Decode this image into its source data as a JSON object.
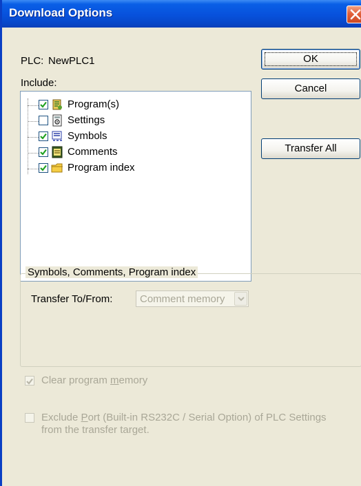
{
  "window": {
    "title": "Download Options"
  },
  "plc": {
    "label": "PLC:",
    "name": "NewPLC1"
  },
  "include": {
    "label": "Include:",
    "items": [
      {
        "label": "Program(s)",
        "checked": true,
        "icon": "program-icon"
      },
      {
        "label": "Settings",
        "checked": false,
        "icon": "settings-icon"
      },
      {
        "label": "Symbols",
        "checked": true,
        "icon": "symbols-icon"
      },
      {
        "label": "Comments",
        "checked": true,
        "icon": "comments-icon"
      },
      {
        "label": "Program index",
        "checked": true,
        "icon": "folder-icon"
      }
    ]
  },
  "buttons": {
    "ok": "OK",
    "cancel": "Cancel",
    "transfer_all": "Transfer All"
  },
  "group": {
    "title": "Symbols, Comments, Program index",
    "transfer_label": "Transfer To/From:",
    "transfer_value": "Comment memory"
  },
  "options": {
    "clear_memory": {
      "prefix": "Clear program ",
      "underlined": "m",
      "suffix": "emory",
      "checked": true,
      "enabled": false
    },
    "exclude_port": {
      "prefix": "Exclude ",
      "underlined": "P",
      "suffix": "ort (Built-in RS232C / Serial Option) of PLC Settings",
      "line2": "from the transfer target.",
      "checked": false,
      "enabled": false
    }
  },
  "colors": {
    "titlebar": "#0751dc",
    "dialog_bg": "#ece9d8",
    "disabled_text": "#a9a797",
    "close_button": "#e2603a"
  }
}
